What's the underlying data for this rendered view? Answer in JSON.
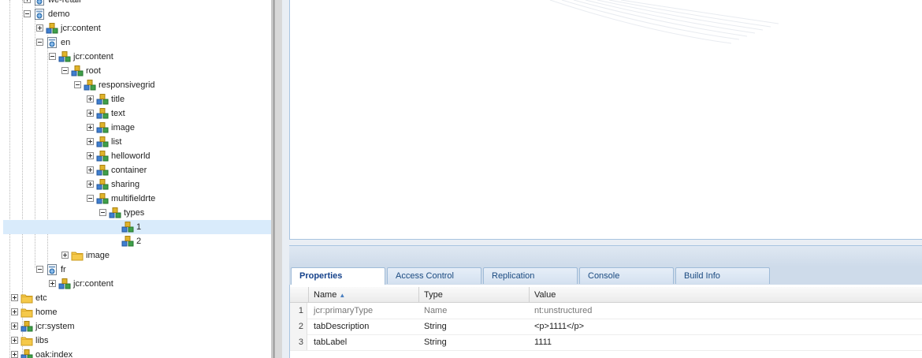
{
  "tree": {
    "nodes": [
      {
        "label": "we-retail",
        "level": 2,
        "icon": "page",
        "expander": "plus"
      },
      {
        "label": "demo",
        "level": 2,
        "icon": "page",
        "expander": "minus"
      },
      {
        "label": "jcr:content",
        "level": 3,
        "icon": "node",
        "expander": "plus"
      },
      {
        "label": "en",
        "level": 3,
        "icon": "page",
        "expander": "minus"
      },
      {
        "label": "jcr:content",
        "level": 4,
        "icon": "node",
        "expander": "minus"
      },
      {
        "label": "root",
        "level": 5,
        "icon": "node",
        "expander": "minus"
      },
      {
        "label": "responsivegrid",
        "level": 6,
        "icon": "node",
        "expander": "minus"
      },
      {
        "label": "title",
        "level": 7,
        "icon": "node",
        "expander": "plus"
      },
      {
        "label": "text",
        "level": 7,
        "icon": "node",
        "expander": "plus"
      },
      {
        "label": "image",
        "level": 7,
        "icon": "node",
        "expander": "plus"
      },
      {
        "label": "list",
        "level": 7,
        "icon": "node",
        "expander": "plus"
      },
      {
        "label": "helloworld",
        "level": 7,
        "icon": "node",
        "expander": "plus"
      },
      {
        "label": "container",
        "level": 7,
        "icon": "node",
        "expander": "plus"
      },
      {
        "label": "sharing",
        "level": 7,
        "icon": "node",
        "expander": "plus"
      },
      {
        "label": "multifieldrte",
        "level": 7,
        "icon": "node",
        "expander": "minus"
      },
      {
        "label": "types",
        "level": 8,
        "icon": "node",
        "expander": "minus"
      },
      {
        "label": "1",
        "level": 9,
        "icon": "node",
        "expander": "none",
        "selected": true
      },
      {
        "label": "2",
        "level": 9,
        "icon": "node",
        "expander": "none"
      },
      {
        "label": "image",
        "level": 5,
        "icon": "folder",
        "expander": "plus"
      },
      {
        "label": "fr",
        "level": 3,
        "icon": "page",
        "expander": "minus"
      },
      {
        "label": "jcr:content",
        "level": 4,
        "icon": "node",
        "expander": "plus"
      },
      {
        "label": "etc",
        "level": 1,
        "icon": "folder",
        "expander": "plus"
      },
      {
        "label": "home",
        "level": 1,
        "icon": "folder",
        "expander": "plus"
      },
      {
        "label": "jcr:system",
        "level": 1,
        "icon": "node",
        "expander": "plus"
      },
      {
        "label": "libs",
        "level": 1,
        "icon": "folder",
        "expander": "plus"
      },
      {
        "label": "oak:index",
        "level": 1,
        "icon": "node",
        "expander": "plus"
      }
    ]
  },
  "tabs": [
    {
      "label": "Properties",
      "active": true
    },
    {
      "label": "Access Control",
      "active": false
    },
    {
      "label": "Replication",
      "active": false
    },
    {
      "label": "Console",
      "active": false
    },
    {
      "label": "Build Info",
      "active": false
    }
  ],
  "properties": {
    "columns": [
      "Name",
      "Type",
      "Value"
    ],
    "rows": [
      {
        "num": "1",
        "name": "jcr:primaryType",
        "type": "Name",
        "value": "nt:unstructured",
        "readonly": true
      },
      {
        "num": "2",
        "name": "tabDescription",
        "type": "String",
        "value": "<p>1111</p>",
        "readonly": false
      },
      {
        "num": "3",
        "name": "tabLabel",
        "type": "String",
        "value": "1111",
        "readonly": false
      }
    ]
  },
  "colors": {
    "selection": "#d9ebfb",
    "tab_text": "#15428b",
    "panel_border": "#a8c4e0"
  }
}
